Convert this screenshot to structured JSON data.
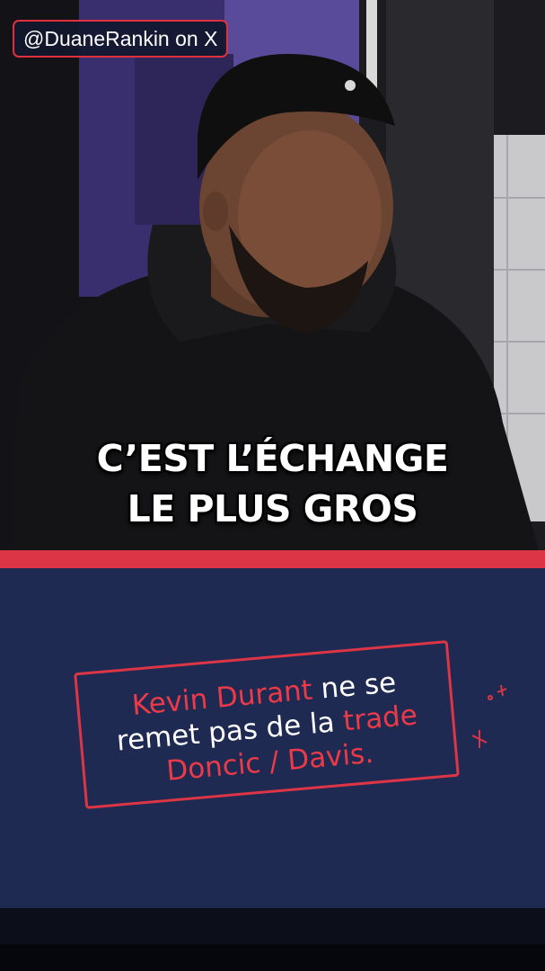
{
  "source_tag": "@DuaneRankin on X",
  "subtitle": {
    "line1": "C’EST L’ÉCHANGE",
    "line2": "LE PLUS GROS"
  },
  "caption": {
    "part1": "Kevin Durant",
    "part2": " ne se",
    "part3": "remet pas de la ",
    "part4": "trade",
    "part5": "Doncic / Davis."
  },
  "colors": {
    "accent_red": "#dc3545",
    "panel_navy": "#1f2a52",
    "text_white": "#ffffff"
  }
}
